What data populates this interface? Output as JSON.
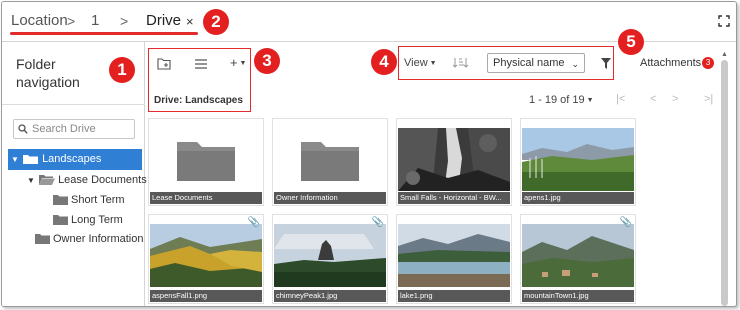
{
  "breadcrumb": {
    "items": [
      "Location",
      "1",
      "Drive"
    ],
    "separator": ">",
    "close_symbol": "×"
  },
  "markers": [
    "1",
    "2",
    "3",
    "4",
    "5"
  ],
  "sidebar": {
    "title": "Folder navigation",
    "search_placeholder": "Search Drive",
    "tree": [
      {
        "label": "Landscapes",
        "level": 0,
        "expanded": true,
        "selected": true
      },
      {
        "label": "Lease Documents",
        "level": 1,
        "expanded": true,
        "selected": false
      },
      {
        "label": "Short Term",
        "level": 2,
        "selected": false
      },
      {
        "label": "Long Term",
        "level": 2,
        "selected": false
      },
      {
        "label": "Owner Information",
        "level": 1,
        "selected": false
      }
    ]
  },
  "toolbar": {
    "drive_label": "Drive:  Landscapes",
    "add_symbol": "+",
    "view_label": "View",
    "sort_select_value": "Physical name",
    "attachments_label": "Attachments",
    "attachments_count": "3"
  },
  "pager": {
    "range": "1 - 19 of 19"
  },
  "tiles": [
    {
      "caption": "Lease Documents",
      "kind": "folder"
    },
    {
      "caption": "Owner Information",
      "kind": "folder"
    },
    {
      "caption": "Small Falls - Horizontal - BW...",
      "kind": "image"
    },
    {
      "caption": "apens1.jpg",
      "kind": "image"
    },
    {
      "caption": "aspensFall1.png",
      "kind": "image"
    },
    {
      "caption": "chimneyPeak1.jpg",
      "kind": "image"
    },
    {
      "caption": "lake1.png",
      "kind": "image"
    },
    {
      "caption": "mountainTown1.jpg",
      "kind": "image"
    }
  ],
  "colors": {
    "accent_blue": "#2f7fd5",
    "marker_red": "#e31f1f",
    "caption_gray": "#585858"
  }
}
